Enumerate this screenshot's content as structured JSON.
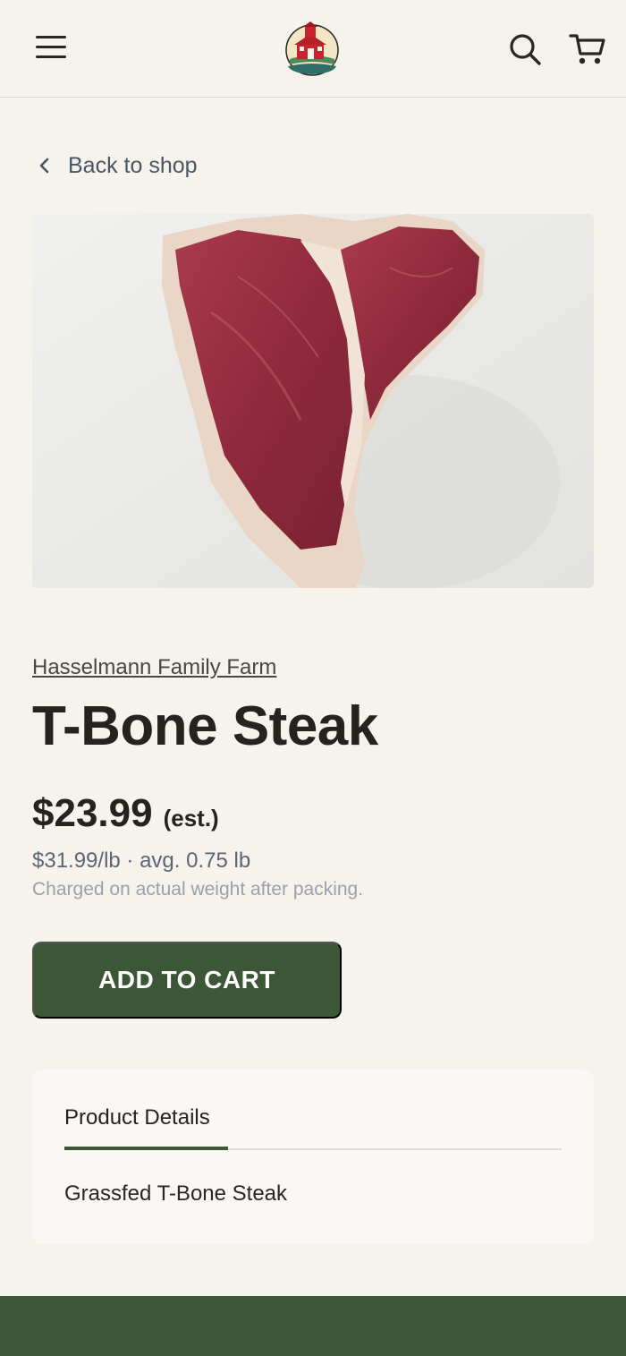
{
  "header": {
    "menu_icon": "hamburger-menu-icon",
    "logo": "farm-barn-logo",
    "search_icon": "search-icon",
    "cart_icon": "shopping-cart-icon"
  },
  "nav": {
    "back_label": "Back to shop",
    "back_icon": "chevron-left-icon"
  },
  "product": {
    "image": "t-bone-steak-photo",
    "farm": "Hasselmann Family Farm",
    "title": "T-Bone Steak",
    "price": "$23.99",
    "price_qualifier": "(est.)",
    "unit_price": "$31.99/lb · avg. 0.75 lb",
    "weight_note": "Charged on actual weight after packing.",
    "add_to_cart_label": "ADD TO CART"
  },
  "details": {
    "tab_label": "Product Details",
    "description": "Grassfed T-Bone Steak"
  },
  "colors": {
    "background": "#f6f2ec",
    "brand_green": "#3c5735",
    "card": "#faf8f5",
    "muted_text": "#5b6574"
  }
}
